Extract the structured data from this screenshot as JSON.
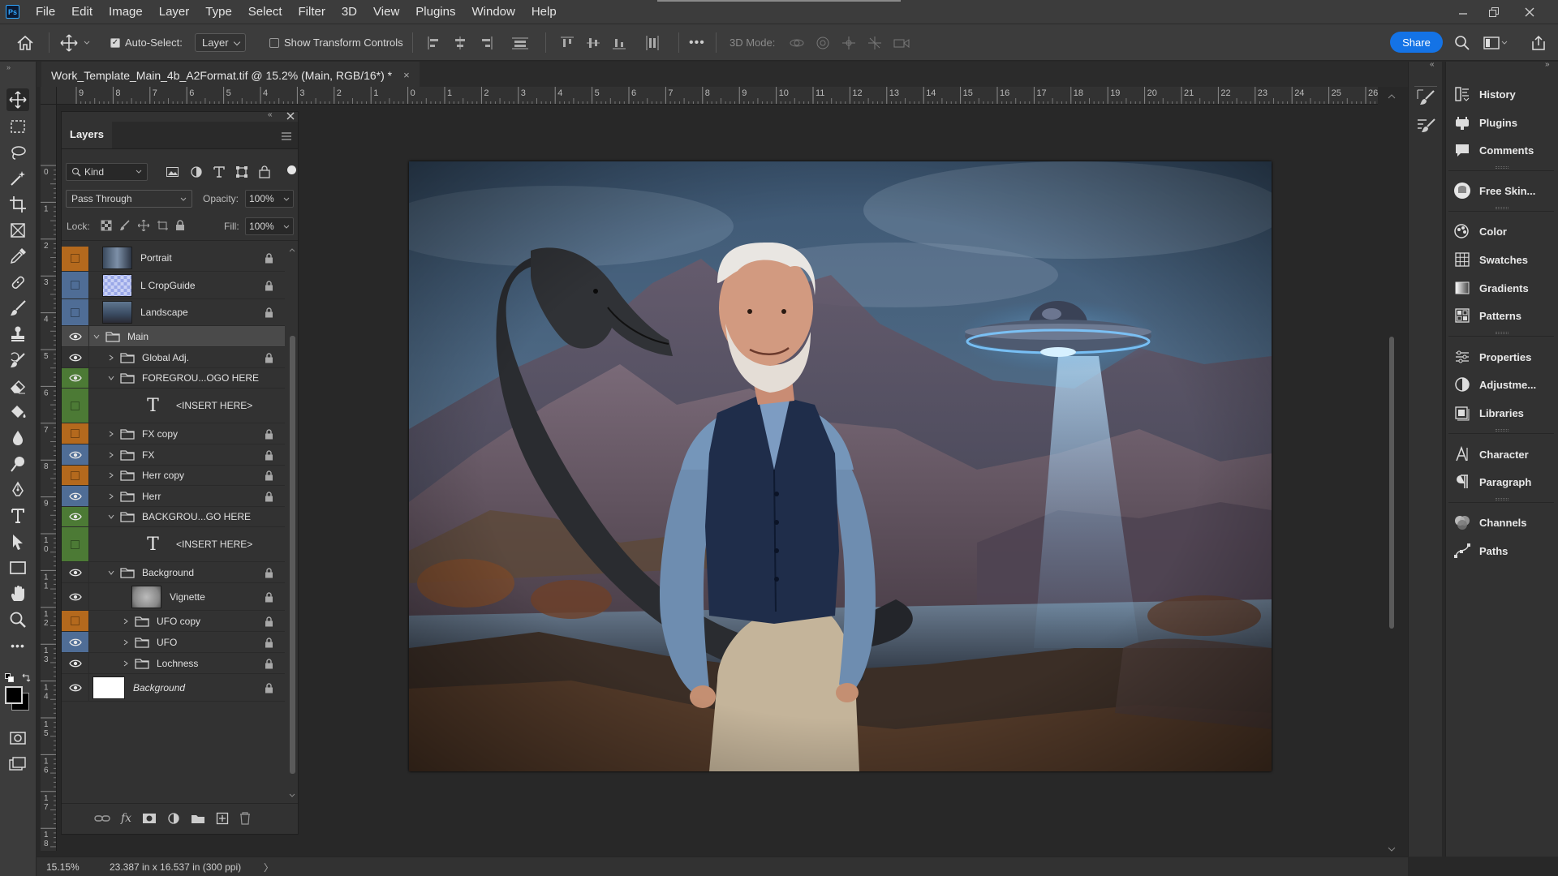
{
  "app": {
    "logo": "Ps"
  },
  "menu": [
    "File",
    "Edit",
    "Image",
    "Layer",
    "Type",
    "Select",
    "Filter",
    "3D",
    "View",
    "Plugins",
    "Window",
    "Help"
  ],
  "options": {
    "auto_select_label": "Auto-Select:",
    "auto_select_target": "Layer",
    "show_transform_label": "Show Transform Controls",
    "mode_3d_label": "3D Mode:",
    "share_label": "Share",
    "more_glyph": "•••"
  },
  "document": {
    "tab_title": "Work_Template_Main_4b_A2Format.tif @ 15.2% (Main, RGB/16*) *",
    "close_glyph": "×"
  },
  "rulers": {
    "h_labels": [
      "9",
      "8",
      "7",
      "6",
      "5",
      "4",
      "3",
      "2",
      "1",
      "0",
      "1",
      "2",
      "3",
      "4",
      "5",
      "6",
      "7",
      "8",
      "9",
      "10",
      "11",
      "12",
      "13",
      "14",
      "15",
      "16",
      "17",
      "18",
      "19",
      "20",
      "21",
      "22",
      "23",
      "24",
      "25",
      "26"
    ],
    "v_labels": [
      "0",
      "1",
      "2",
      "3",
      "4",
      "5",
      "6",
      "7",
      "8",
      "9",
      "1 0",
      "1 1",
      "1 2",
      "1 3",
      "1 4",
      "1 5",
      "1 6",
      "1 7",
      "1 8"
    ]
  },
  "layers_panel": {
    "title": "Layers",
    "filter_kind": "Kind",
    "blend_mode": "Pass Through",
    "opacity_label": "Opacity:",
    "opacity_value": "100%",
    "lock_label": "Lock:",
    "fill_label": "Fill:",
    "fill_value": "100%",
    "layers": [
      {
        "name": "Portrait",
        "vis": "orange",
        "kind": "image",
        "thumb": "portrait",
        "indent": 0,
        "locked": true,
        "visible": false
      },
      {
        "name": "L CropGuide",
        "vis": "blue",
        "kind": "image",
        "thumb": "checker",
        "indent": 0,
        "locked": true,
        "visible": false
      },
      {
        "name": "Landscape",
        "vis": "blue",
        "kind": "image",
        "thumb": "landscape",
        "indent": 0,
        "locked": true,
        "visible": false
      },
      {
        "name": "Main",
        "vis": "none",
        "kind": "group",
        "expanded": true,
        "indent": 0,
        "locked": false,
        "visible": true,
        "selected": true
      },
      {
        "name": "Global Adj.",
        "vis": "none",
        "kind": "group",
        "expanded": false,
        "indent": 1,
        "locked": true,
        "visible": true
      },
      {
        "name": "FOREGROU...OGO HERE",
        "vis": "green",
        "kind": "group",
        "expanded": true,
        "indent": 1,
        "locked": false,
        "visible": true
      },
      {
        "name": "<INSERT HERE>",
        "vis": "green",
        "kind": "text",
        "indent": 2,
        "locked": false,
        "visible": false
      },
      {
        "name": "FX copy",
        "vis": "orange",
        "kind": "group",
        "expanded": false,
        "indent": 1,
        "locked": true,
        "visible": false
      },
      {
        "name": "FX",
        "vis": "blue",
        "kind": "group",
        "expanded": false,
        "indent": 1,
        "locked": true,
        "visible": true
      },
      {
        "name": "Herr copy",
        "vis": "orange",
        "kind": "group",
        "expanded": false,
        "indent": 1,
        "locked": true,
        "visible": false
      },
      {
        "name": "Herr",
        "vis": "blue",
        "kind": "group",
        "expanded": false,
        "indent": 1,
        "locked": true,
        "visible": true
      },
      {
        "name": "BACKGROU...GO  HERE",
        "vis": "green",
        "kind": "group",
        "expanded": true,
        "indent": 1,
        "locked": false,
        "visible": true
      },
      {
        "name": "<INSERT HERE>",
        "vis": "green",
        "kind": "text",
        "indent": 2,
        "locked": false,
        "visible": false
      },
      {
        "name": "Background",
        "vis": "none",
        "kind": "group",
        "expanded": true,
        "indent": 1,
        "locked": true,
        "visible": true
      },
      {
        "name": "Vignette",
        "vis": "none",
        "kind": "image",
        "thumb": "vignette",
        "indent": 2,
        "locked": true,
        "visible": true
      },
      {
        "name": "UFO copy",
        "vis": "orange",
        "kind": "group",
        "expanded": false,
        "indent": 2,
        "locked": true,
        "visible": false
      },
      {
        "name": "UFO",
        "vis": "blue",
        "kind": "group",
        "expanded": false,
        "indent": 2,
        "locked": true,
        "visible": true
      },
      {
        "name": "Lochness",
        "vis": "none",
        "kind": "group",
        "expanded": false,
        "indent": 2,
        "locked": true,
        "visible": true
      },
      {
        "name": "Background",
        "vis": "none",
        "kind": "bg",
        "thumb": "white",
        "indent": 0,
        "locked": true,
        "visible": true,
        "italic": true
      }
    ]
  },
  "right_panel": {
    "items": [
      "History",
      "Plugins",
      "Comments",
      "Free Skin...",
      "Color",
      "Swatches",
      "Gradients",
      "Patterns",
      "Properties",
      "Adjustme...",
      "Libraries",
      "Character",
      "Paragraph",
      "Channels",
      "Paths"
    ]
  },
  "status": {
    "zoom": "15.15%",
    "doc_info": "23.387 in x 16.537 in (300 ppi)",
    "arrow": "〉"
  },
  "colors": {
    "accent": "#1473e6",
    "panel": "#323232",
    "bar": "#3c3c3c",
    "label_orange": "#b4691d",
    "label_blue": "#4f6d96",
    "label_green": "#4c7a35"
  }
}
